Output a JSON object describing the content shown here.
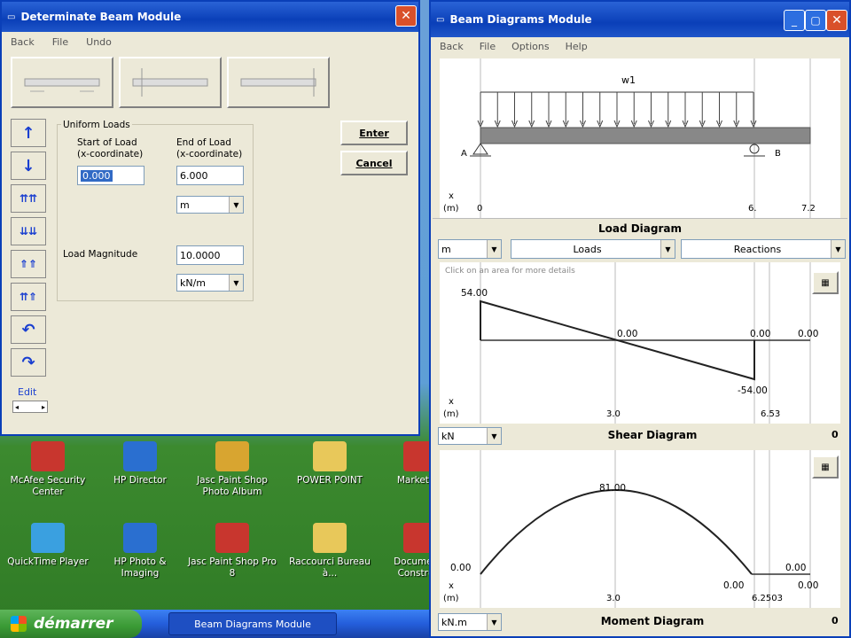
{
  "left_window": {
    "title": "Determinate Beam Module",
    "menu": [
      "Back",
      "File",
      "Undo"
    ],
    "group_title": "Uniform Loads",
    "start_label_1": "Start of Load",
    "start_label_2": "(x-coordinate)",
    "end_label_1": "End of Load",
    "end_label_2": "(x-coordinate)",
    "start_value": "0.000",
    "end_value": "6.000",
    "length_unit": "m",
    "magnitude_label": "Load Magnitude",
    "magnitude_value": "10.0000",
    "magnitude_unit": "kN/m",
    "enter_label": "Enter",
    "cancel_label": "Cancel",
    "edit_label": "Edit"
  },
  "right_window": {
    "title": "Beam Diagrams Module",
    "menu": [
      "Back",
      "File",
      "Options",
      "Help"
    ],
    "load_diagram": {
      "load_label": "w1",
      "support_a": "A",
      "support_b": "B",
      "x_label": "x",
      "x_unit": "(m)",
      "ticks": [
        "0",
        "6.",
        "7.2"
      ],
      "title": "Load Diagram"
    },
    "controls": {
      "unit": "m",
      "loads": "Loads",
      "reactions": "Reactions"
    },
    "shear_diagram": {
      "hint": "Click on an area for more details",
      "x_label": "x",
      "x_unit": "(m)",
      "labels": [
        "54.00",
        "0.00",
        "0.00",
        "0.00",
        "-54.00"
      ],
      "ticks": [
        "3.0",
        "6.53"
      ],
      "unit": "kN",
      "title": "Shear Diagram",
      "corner": "0"
    },
    "moment_diagram": {
      "x_label": "x",
      "x_unit": "(m)",
      "labels": [
        "81.00",
        "0.00",
        "0.00",
        "0.00",
        "0.00"
      ],
      "ticks": [
        "3.0",
        "6.2503"
      ],
      "unit": "kN.m",
      "title": "Moment Diagram",
      "corner": "0"
    }
  },
  "desktop_icons": [
    {
      "label": "McAfee Security Center",
      "color": "#c8362e"
    },
    {
      "label": "HP Director",
      "color": "#2a6fd0"
    },
    {
      "label": "Jasc Paint Shop Photo Album",
      "color": "#d8a530"
    },
    {
      "label": "POWER POINT",
      "color": "#e8c85a"
    },
    {
      "label": "Marketing",
      "color": "#c8362e"
    },
    {
      "label": "QuickTime Player",
      "color": "#3aa0e0"
    },
    {
      "label": "HP Photo & Imaging",
      "color": "#2a6fd0"
    },
    {
      "label": "Jasc Paint Shop Pro 8",
      "color": "#c8362e"
    },
    {
      "label": "Raccourci Bureau à...",
      "color": "#e8c85a"
    },
    {
      "label": "Documents Construct",
      "color": "#c8362e"
    }
  ],
  "taskbar": {
    "start": "démarrer",
    "task": "Beam Diagrams Module"
  }
}
